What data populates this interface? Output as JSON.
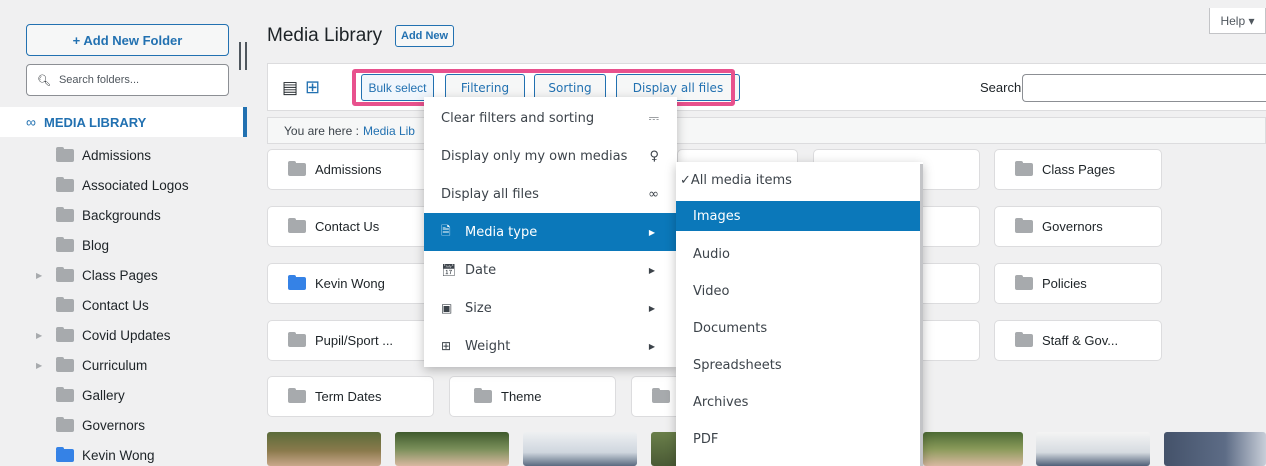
{
  "sidebar": {
    "add_folder": "+ Add New Folder",
    "search_placeholder": "Search folders...",
    "root": "MEDIA LIBRARY",
    "folders": [
      {
        "label": "Admissions",
        "arrow": false,
        "color": "gray"
      },
      {
        "label": "Associated Logos",
        "arrow": false,
        "color": "gray"
      },
      {
        "label": "Backgrounds",
        "arrow": false,
        "color": "gray"
      },
      {
        "label": "Blog",
        "arrow": false,
        "color": "gray"
      },
      {
        "label": "Class Pages",
        "arrow": true,
        "color": "gray"
      },
      {
        "label": "Contact Us",
        "arrow": false,
        "color": "gray"
      },
      {
        "label": "Covid Updates",
        "arrow": true,
        "color": "gray"
      },
      {
        "label": "Curriculum",
        "arrow": true,
        "color": "gray"
      },
      {
        "label": "Gallery",
        "arrow": false,
        "color": "gray"
      },
      {
        "label": "Governors",
        "arrow": false,
        "color": "gray"
      },
      {
        "label": "Kevin Wong",
        "arrow": false,
        "color": "blue"
      }
    ]
  },
  "header": {
    "title": "Media Library",
    "add_new": "Add New",
    "help": "Help ▾"
  },
  "toolbar": {
    "bulk_select": "Bulk select",
    "filtering": "Filtering",
    "sorting": "Sorting",
    "display_all": "Display all files",
    "search_label": "Search"
  },
  "breadcrumb": {
    "prefix": "You are here :",
    "current": "Media Lib"
  },
  "cards": {
    "admissions": "Admissions",
    "contact_us": "Contact Us",
    "kevin_wong": "Kevin Wong",
    "pupil_sport": "Pupil/Sport ...",
    "term_dates": "Term Dates",
    "theme": "Theme",
    "class_pages": "Class Pages",
    "governors": "Governors",
    "policies": "Policies",
    "staff_gov": "Staff & Gov..."
  },
  "filter_menu": {
    "clear": "Clear filters and sorting",
    "own_medias": "Display only my own medias",
    "display_all": "Display all files",
    "media_type": "Media type",
    "date": "Date",
    "size": "Size",
    "weight": "Weight"
  },
  "media_type_menu": {
    "all": "✓All media items",
    "images": "Images",
    "audio": "Audio",
    "video": "Video",
    "documents": "Documents",
    "spreadsheets": "Spreadsheets",
    "archives": "Archives",
    "pdf": "PDF"
  },
  "colors": {
    "accent": "#2271b1",
    "menu_active": "#0b78ba",
    "highlight": "#e8518d",
    "folder_gray": "#a7aaad",
    "folder_blue": "#3582e6"
  }
}
